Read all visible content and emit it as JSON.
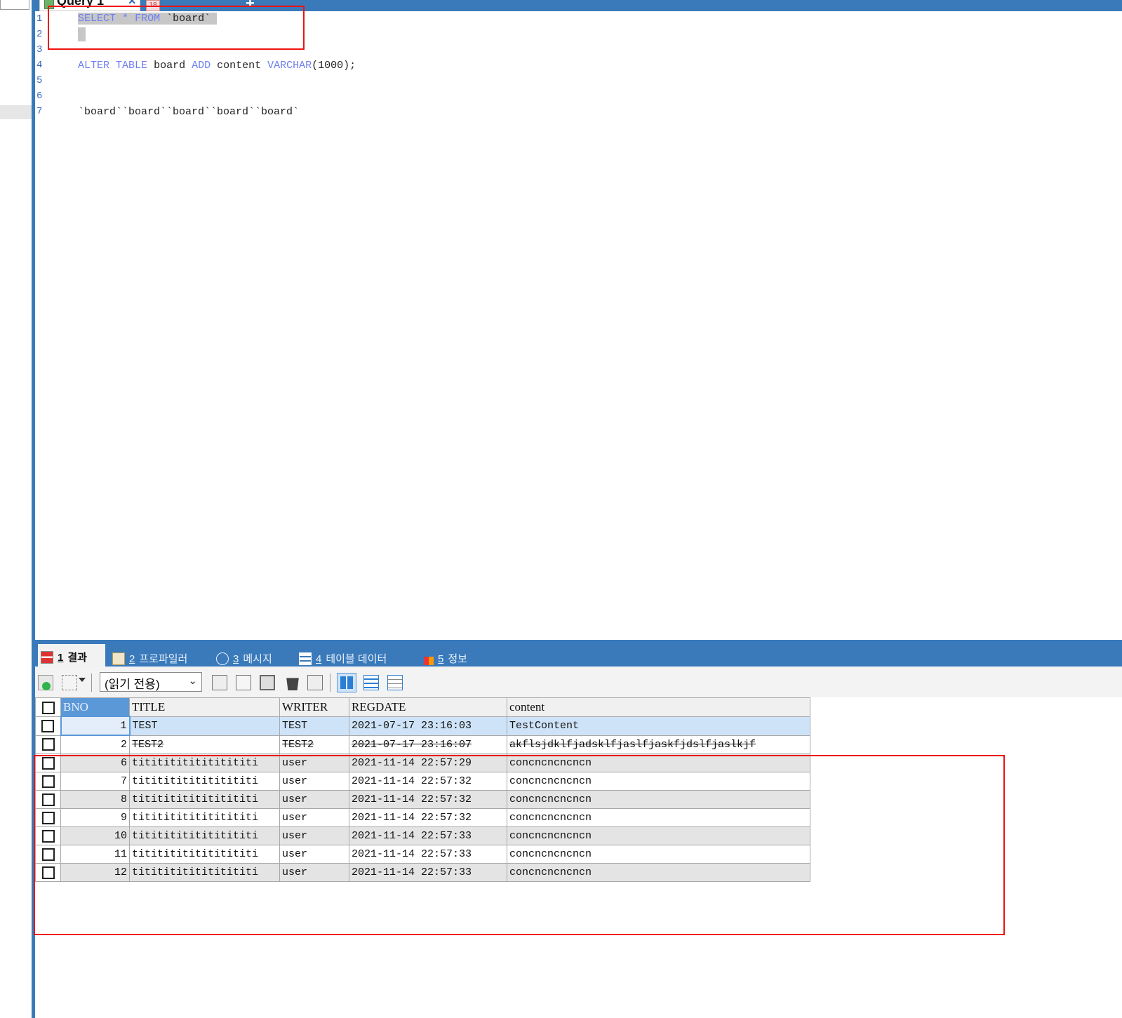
{
  "query_tabs": {
    "active_label": "Query 1",
    "close_glyph": "×",
    "second_icon": "18",
    "second_label": "",
    "add_glyph": "+"
  },
  "editor": {
    "line_numbers": [
      "1",
      "2",
      "3",
      "4",
      "5",
      "6",
      "7"
    ],
    "line1": {
      "kw1": "SELECT",
      "star": "*",
      "kw2": "FROM",
      "rest": "`board`"
    },
    "line4": {
      "kw1": "ALTER",
      "kw2": "TABLE",
      "t1": "board",
      "kw3": "ADD",
      "t2": "content",
      "kw4": "VARCHAR",
      "t3": "(1000);"
    },
    "line7": "`board``board``board``board``board`"
  },
  "result_tabs": [
    {
      "num": "1",
      "label": "결과",
      "icon": "grid-result-icon"
    },
    {
      "num": "2",
      "label": "프로파일러",
      "icon": "profiler-icon"
    },
    {
      "num": "3",
      "label": "메시지",
      "icon": "info-icon"
    },
    {
      "num": "4",
      "label": "테이블 데이터",
      "icon": "table-data-icon"
    },
    {
      "num": "5",
      "label": "정보",
      "icon": "chart-info-icon"
    }
  ],
  "toolbar": {
    "readonly_value": "(읽기 전용)",
    "dropdown_arrow": "⌄"
  },
  "grid": {
    "columns": [
      "BNO",
      "TITLE",
      "WRITER",
      "REGDATE",
      "content"
    ],
    "rows": [
      {
        "bno": "1",
        "title": "TEST",
        "writer": "TEST",
        "regdate": "2021-07-17 23:16:03",
        "content": "TestContent"
      },
      {
        "bno": "2",
        "title": "TEST2",
        "writer": "TEST2",
        "regdate": "2021-07-17 23:16:07",
        "content": "akflsjdklfjadsklfjaslfjaskfjdslfjaslkjf"
      },
      {
        "bno": "6",
        "title": "titititititititititi",
        "writer": "user",
        "regdate": "2021-11-14 22:57:29",
        "content": "concncncncncn"
      },
      {
        "bno": "7",
        "title": "titititititititititi",
        "writer": "user",
        "regdate": "2021-11-14 22:57:32",
        "content": "concncncncncn"
      },
      {
        "bno": "8",
        "title": "titititititititititi",
        "writer": "user",
        "regdate": "2021-11-14 22:57:32",
        "content": "concncncncncn"
      },
      {
        "bno": "9",
        "title": "titititititititititi",
        "writer": "user",
        "regdate": "2021-11-14 22:57:32",
        "content": "concncncncncn"
      },
      {
        "bno": "10",
        "title": "titititititititititi",
        "writer": "user",
        "regdate": "2021-11-14 22:57:33",
        "content": "concncncncncn"
      },
      {
        "bno": "11",
        "title": "titititititititititi",
        "writer": "user",
        "regdate": "2021-11-14 22:57:33",
        "content": "concncncncncn"
      },
      {
        "bno": "12",
        "title": "titititititititititi",
        "writer": "user",
        "regdate": "2021-11-14 22:57:33",
        "content": "concncncncncn"
      }
    ]
  },
  "colors": {
    "tabbar_blue": "#3a7abb",
    "keyword": "#6f7ff0",
    "line_number": "#3a68c4",
    "annotation_red": "#e11111",
    "selected_row": "#cfe3f8"
  }
}
